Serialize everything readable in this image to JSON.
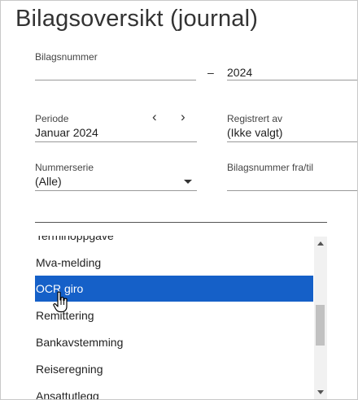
{
  "title": "Bilagsoversikt (journal)",
  "bilagsnummer": {
    "label": "Bilagsnummer",
    "value": "",
    "separator": "–",
    "year": "2024"
  },
  "periode": {
    "label": "Periode",
    "value": "Januar 2024",
    "prev_icon": "chevron-left-icon",
    "next_icon": "chevron-right-icon"
  },
  "registrert_av": {
    "label": "Registrert av",
    "value": "(Ikke valgt)"
  },
  "nummerserie": {
    "label": "Nummerserie",
    "value": "(Alle)",
    "icon": "caret-down-icon"
  },
  "bilagsnummer_fra_til": {
    "label": "Bilagsnummer fra/til",
    "value": ""
  },
  "search": {
    "value": ""
  },
  "dropdown": {
    "items": [
      {
        "label": "Terminoppgave",
        "selected": false
      },
      {
        "label": "Mva-melding",
        "selected": false
      },
      {
        "label": "OCR giro",
        "selected": true
      },
      {
        "label": "Remittering",
        "selected": false
      },
      {
        "label": "Bankavstemming",
        "selected": false
      },
      {
        "label": "Reiseregning",
        "selected": false
      },
      {
        "label": "Ansattutlegg",
        "selected": false
      }
    ]
  },
  "colors": {
    "selection": "#1560c8",
    "text": "#222222"
  }
}
